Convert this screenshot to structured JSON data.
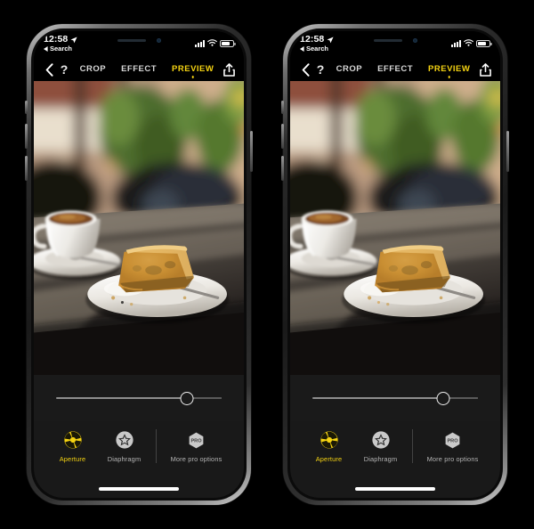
{
  "background_color": "#000000",
  "accent_color": "#f5d312",
  "panel_color": "#191919",
  "phones": [
    {
      "id": "phone-left",
      "status_bar": {
        "time": "12:58",
        "location_icon": "location-arrow-icon",
        "back_app_chevron": "back-triangle-icon",
        "back_app_label": "Search",
        "signal_icon": "cellular-signal-icon",
        "wifi_icon": "wifi-icon",
        "battery_icon": "battery-icon"
      },
      "toolbar": {
        "back_icon": "chevron-left-icon",
        "help_icon": "question-mark-icon",
        "help_label": "?",
        "share_icon": "share-upload-icon",
        "tabs": [
          {
            "label": "CROP",
            "active": false
          },
          {
            "label": "EFFECT",
            "active": false
          },
          {
            "label": "PREVIEW",
            "active": true
          }
        ]
      },
      "photo": {
        "alt": "espresso cup and slice of cake on cafe table with blurred bokeh background",
        "colors": {
          "bg_warm": "#c9a48a",
          "bg_wall": "#d8c0a4",
          "plant_green": "#5c7a37",
          "table_dark": "#2e2a26",
          "table_light": "#8d8378",
          "plate_white": "#f2f0ec",
          "cake_gold": "#d49a3f",
          "coffee_brown": "#8a5a2c",
          "chair_black": "#16161a"
        }
      },
      "slider": {
        "name": "aperture-slider",
        "value_percent": 79,
        "min": 0,
        "max": 100
      },
      "tools": [
        {
          "label": "Aperture",
          "icon": "aperture-iris-icon",
          "active": true
        },
        {
          "label": "Diaphragm",
          "icon": "diaphragm-star-icon",
          "active": false
        },
        {
          "label": "More pro options",
          "icon": "pro-hexagon-badge-icon",
          "active": false,
          "badge_text": "PRO"
        }
      ],
      "home_indicator": "home-indicator-bar"
    },
    {
      "id": "phone-right",
      "status_bar": {
        "time": "12:58",
        "location_icon": "location-arrow-icon",
        "back_app_chevron": "back-triangle-icon",
        "back_app_label": "Search",
        "signal_icon": "cellular-signal-icon",
        "wifi_icon": "wifi-icon",
        "battery_icon": "battery-icon"
      },
      "toolbar": {
        "back_icon": "chevron-left-icon",
        "help_icon": "question-mark-icon",
        "help_label": "?",
        "share_icon": "share-upload-icon",
        "tabs": [
          {
            "label": "CROP",
            "active": false
          },
          {
            "label": "EFFECT",
            "active": false
          },
          {
            "label": "PREVIEW",
            "active": true
          }
        ]
      },
      "photo": {
        "alt": "espresso cup and slice of cake on cafe table with blurred bokeh background",
        "colors": {
          "bg_warm": "#c9a48a",
          "bg_wall": "#d8c0a4",
          "plant_green": "#5c7a37",
          "table_dark": "#2e2a26",
          "table_light": "#8d8378",
          "plate_white": "#f2f0ec",
          "cake_gold": "#d49a3f",
          "coffee_brown": "#8a5a2c",
          "chair_black": "#16161a"
        }
      },
      "slider": {
        "name": "aperture-slider",
        "value_percent": 79,
        "min": 0,
        "max": 100
      },
      "tools": [
        {
          "label": "Aperture",
          "icon": "aperture-iris-icon",
          "active": true
        },
        {
          "label": "Diaphragm",
          "icon": "diaphragm-star-icon",
          "active": false
        },
        {
          "label": "More pro options",
          "icon": "pro-hexagon-badge-icon",
          "active": false,
          "badge_text": "PRO"
        }
      ],
      "home_indicator": "home-indicator-bar"
    }
  ]
}
